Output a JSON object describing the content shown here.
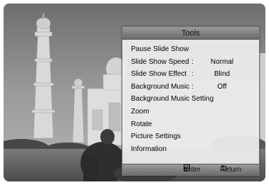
{
  "tools_menu": {
    "title": "Tools",
    "items": [
      {
        "label": "Pause Slide Show"
      },
      {
        "label": "Slide Show Speed",
        "separator": ":",
        "value": "Normal"
      },
      {
        "label": "Slide Show Effect",
        "separator": ":",
        "value": "Blind"
      },
      {
        "label": "Background Music",
        "separator": ":",
        "value": "Off"
      },
      {
        "label": "Background Music Setting"
      },
      {
        "label": "Zoom"
      },
      {
        "label": "Rotate"
      },
      {
        "label": "Picture Settings"
      },
      {
        "label": "Information"
      }
    ],
    "footer": {
      "enter_label": "Enter",
      "enter_icon": "enter-icon",
      "return_label": "Return",
      "return_icon": "return-icon"
    }
  }
}
